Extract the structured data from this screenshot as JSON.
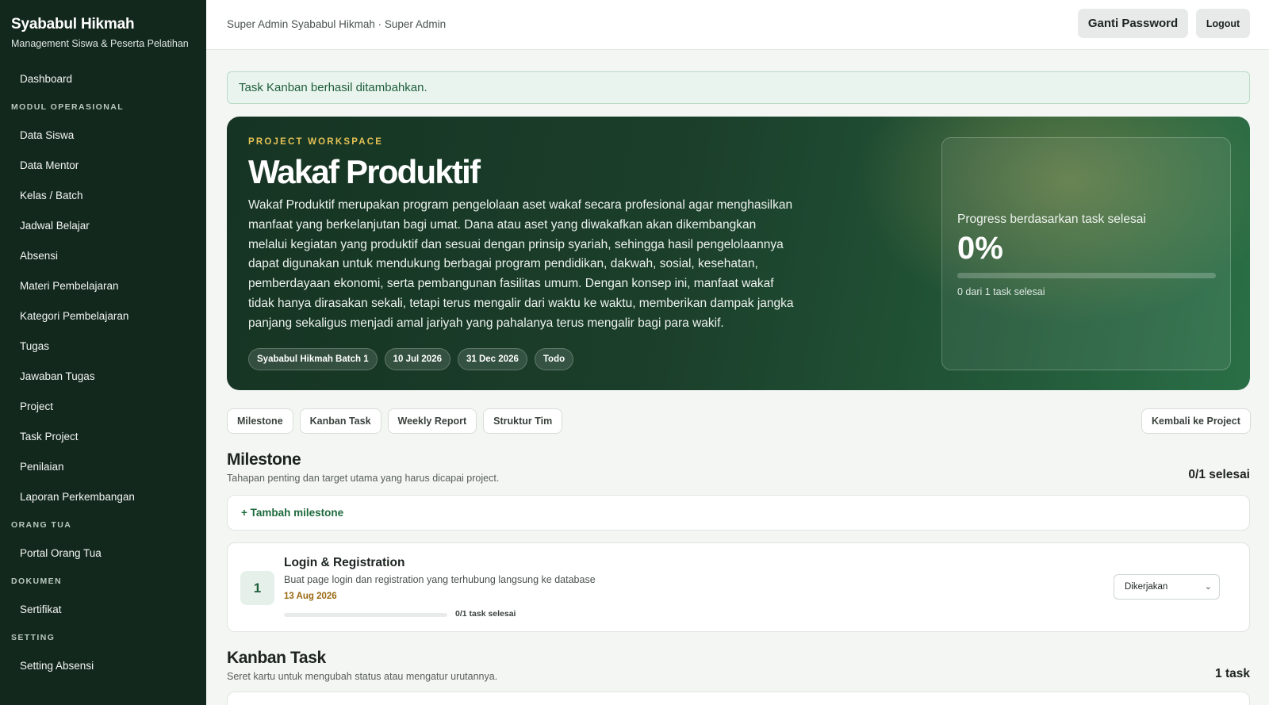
{
  "brand": {
    "title": "Syababul Hikmah",
    "subtitle": "Management Siswa & Peserta Pelatihan"
  },
  "sidebar": {
    "dashboard": "Dashboard",
    "section_operasional": "MODUL OPERASIONAL",
    "operasional": [
      "Data Siswa",
      "Data Mentor",
      "Kelas / Batch",
      "Jadwal Belajar",
      "Absensi",
      "Materi Pembelajaran",
      "Kategori Pembelajaran",
      "Tugas",
      "Jawaban Tugas",
      "Project",
      "Task Project",
      "Penilaian",
      "Laporan Perkembangan"
    ],
    "section_orangtua": "ORANG TUA",
    "orangtua": [
      "Portal Orang Tua"
    ],
    "section_dokumen": "DOKUMEN",
    "dokumen": [
      "Sertifikat"
    ],
    "section_setting": "SETTING",
    "setting": [
      "Setting Absensi"
    ]
  },
  "topbar": {
    "user": "Super Admin Syababul Hikmah · Super Admin",
    "change_password": "Ganti Password",
    "logout": "Logout"
  },
  "alert": {
    "message": "Task Kanban berhasil ditambahkan."
  },
  "hero": {
    "eyebrow": "PROJECT WORKSPACE",
    "title": "Wakaf Produktif",
    "description": "Wakaf Produktif merupakan program pengelolaan aset wakaf secara profesional agar menghasilkan manfaat yang berkelanjutan bagi umat. Dana atau aset yang diwakafkan akan dikembangkan melalui kegiatan yang produktif dan sesuai dengan prinsip syariah, sehingga hasil pengelolaannya dapat digunakan untuk mendukung berbagai program pendidikan, dakwah, sosial, kesehatan, pemberdayaan ekonomi, serta pembangunan fasilitas umum. Dengan konsep ini, manfaat wakaf tidak hanya dirasakan sekali, tetapi terus mengalir dari waktu ke waktu, memberikan dampak jangka panjang sekaligus menjadi amal jariyah yang pahalanya terus mengalir bagi para wakif.",
    "chips": {
      "batch": "Syababul Hikmah Batch 1",
      "start": "10 Jul 2026",
      "end": "31 Dec 2026",
      "status": "Todo"
    },
    "progress": {
      "label": "Progress berdasarkan task selesai",
      "value": "0%",
      "fraction": 0,
      "summary": "0 dari 1 task selesai"
    }
  },
  "tabs": {
    "milestone": "Milestone",
    "kanban": "Kanban Task",
    "weekly": "Weekly Report",
    "struktur": "Struktur Tim",
    "back": "Kembali ke Project"
  },
  "milestone_section": {
    "title": "Milestone",
    "subtitle": "Tahapan penting dan target utama yang harus dicapai project.",
    "count": "0/1 selesai",
    "add_label": "+ Tambah milestone",
    "item": {
      "number": "1",
      "title": "Login & Registration",
      "description": "Buat page login dan registration yang terhubung langsung ke database",
      "date": "13 Aug 2026",
      "progress_fraction": 0,
      "progress_label": "0/1 task selesai",
      "status": "Dikerjakan"
    }
  },
  "kanban_section": {
    "title": "Kanban Task",
    "subtitle": "Seret kartu untuk mengubah status atau mengatur urutannya.",
    "count": "1 task"
  },
  "colors": {
    "sidebar_bg": "#13281d",
    "accent_gold": "#e4c255",
    "accent_green": "#1e6a3c"
  }
}
